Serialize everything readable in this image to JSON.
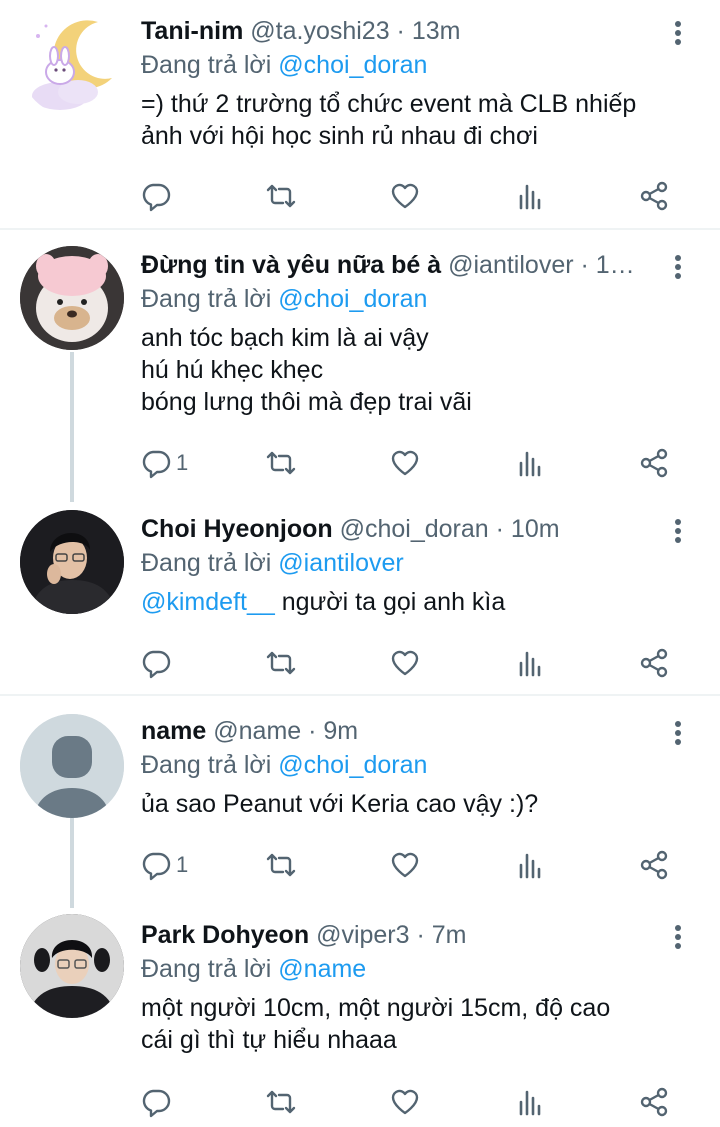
{
  "tweets": [
    {
      "name": "Tani-nim",
      "handle": "@ta.yoshi23 · 13m",
      "replying_prefix": "Đang trả lời",
      "replying_to": "@choi_doran",
      "lines": [
        "=) thứ 2 trường tổ chức event mà CLB nhiếp",
        "ảnh với hội học sinh rủ nhau đi chơi"
      ],
      "reply_count": "",
      "avatar": "moon-bunny-illustration"
    },
    {
      "name": "Đừng tin và yêu nữa bé à",
      "handle": "@iantilover · 1…",
      "replying_prefix": "Đang trả lời",
      "replying_to": "@choi_doran",
      "lines": [
        "anh tóc bạch kim là ai vậy",
        "hú hú khẹc khẹc",
        "bóng lưng thôi mà đẹp trai vãi"
      ],
      "reply_count": "1",
      "avatar": "plush-toy-photo"
    },
    {
      "name": "Choi Hyeonjoon",
      "handle": "@choi_doran · 10m",
      "replying_prefix": "Đang trả lời",
      "replying_to": "@iantilover",
      "body_mention": "@kimdeft__",
      "lines": [
        "người ta gọi anh kìa"
      ],
      "reply_count": "",
      "avatar": "man-portrait-photo"
    },
    {
      "name": "name",
      "handle": "@name · 9m",
      "replying_prefix": "Đang trả lời",
      "replying_to": "@choi_doran",
      "lines": [
        "ủa sao Peanut với Keria cao vậy :)?"
      ],
      "reply_count": "1",
      "avatar": "default-user-silhouette"
    },
    {
      "name": "Park Dohyeon",
      "handle": "@viper3 · 7m",
      "replying_prefix": "Đang trả lời",
      "replying_to": "@name",
      "lines": [
        "một người 10cm, một người 15cm, độ cao",
        "cái gì thì tự hiểu nhaaa"
      ],
      "reply_count": "",
      "avatar": "man-portrait-photo"
    }
  ],
  "icons": {
    "reply": "reply-icon",
    "retweet": "retweet-icon",
    "like": "heart-icon",
    "views": "views-icon",
    "share": "share-icon",
    "more": "more-options-icon"
  },
  "colors": {
    "accent": "#1d9bf0",
    "text": "#0f1419",
    "muted": "#536471",
    "divider": "#eff3f4",
    "thread": "#cfd9de"
  }
}
